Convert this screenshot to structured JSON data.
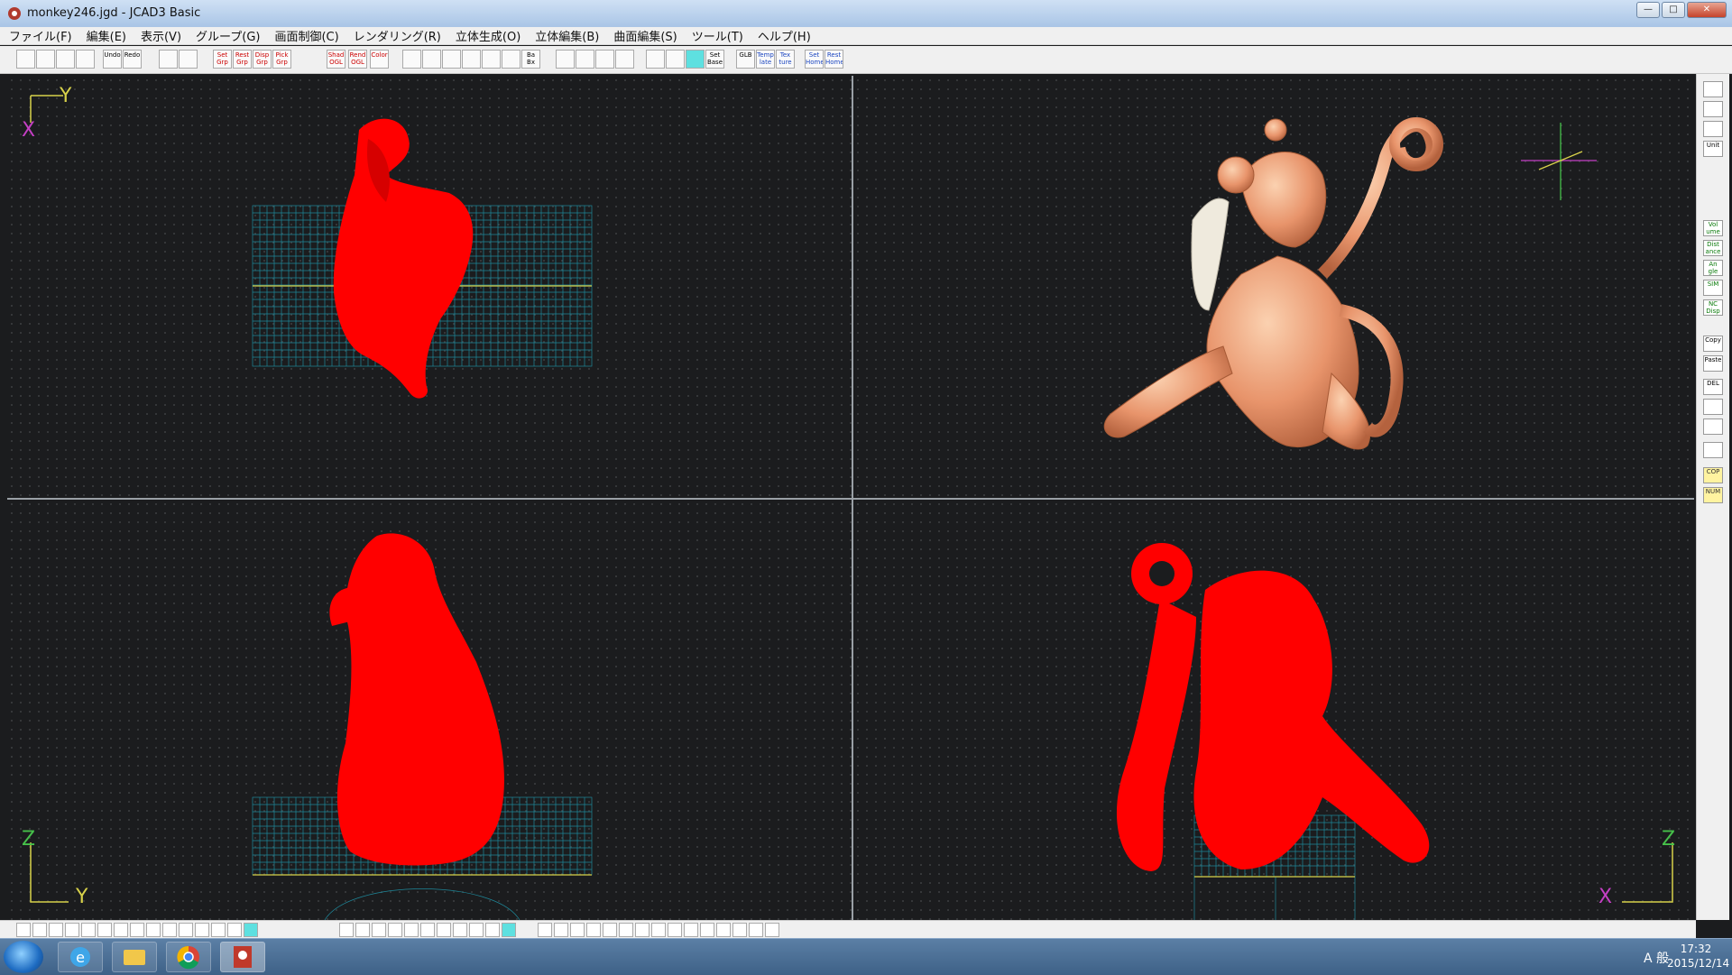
{
  "window": {
    "title": "monkey246.jgd - JCAD3 Basic",
    "buttons": [
      "—",
      "□",
      "✕"
    ]
  },
  "menu": [
    "ファイル(F)",
    "編集(E)",
    "表示(V)",
    "グループ(G)",
    "画面制御(C)",
    "レンダリング(R)",
    "立体生成(O)",
    "立体編集(B)",
    "曲面編集(S)",
    "ツール(T)",
    "ヘルプ(H)"
  ],
  "toolbar": {
    "buttons": [
      {
        "label": "",
        "name": "new-file"
      },
      {
        "label": "",
        "name": "open-file"
      },
      {
        "label": "",
        "name": "save-file"
      },
      {
        "label": "",
        "name": "print"
      },
      {
        "label": "Undo",
        "name": "undo"
      },
      {
        "label": "Redo",
        "name": "redo"
      },
      {
        "label": "",
        "name": "group-view"
      },
      {
        "label": "",
        "name": "group-list"
      },
      {
        "label": "Set Grp",
        "name": "set-group"
      },
      {
        "label": "Rest Grp",
        "name": "reset-group"
      },
      {
        "label": "Disp Grp",
        "name": "display-group"
      },
      {
        "label": "Pick Grp",
        "name": "pick-group"
      },
      {
        "label": "Shad OGL",
        "name": "shade-ogl"
      },
      {
        "label": "Rend OGL",
        "name": "render-ogl"
      },
      {
        "label": "Color",
        "name": "color"
      },
      {
        "label": "",
        "name": "zoom-in"
      },
      {
        "label": "",
        "name": "zoom-out"
      },
      {
        "label": "",
        "name": "zoom-fit"
      },
      {
        "label": "",
        "name": "zoom-window"
      },
      {
        "label": "",
        "name": "zoom-all"
      },
      {
        "label": "",
        "name": "pan-hand"
      },
      {
        "label": "Ba Bx",
        "name": "bbox"
      },
      {
        "label": "",
        "name": "zoom-red-1"
      },
      {
        "label": "",
        "name": "zoom-red-2"
      },
      {
        "label": "",
        "name": "zoom-red-3"
      },
      {
        "label": "",
        "name": "zoom-red-4"
      },
      {
        "label": "",
        "name": "grid-1"
      },
      {
        "label": "",
        "name": "grid-2"
      },
      {
        "label": "",
        "name": "grid-3"
      },
      {
        "label": "Set Base",
        "name": "set-base"
      },
      {
        "label": "GLB",
        "name": "global"
      },
      {
        "label": "Temp late",
        "name": "template"
      },
      {
        "label": "Tex ture",
        "name": "texture"
      },
      {
        "label": "Set Home",
        "name": "set-home"
      },
      {
        "label": "Rest Home",
        "name": "reset-home"
      }
    ]
  },
  "views": {
    "top_left": {
      "axis_v": "Y",
      "axis_h": "X"
    },
    "bottom_left": {
      "axis_v": "Z",
      "axis_h": "Y"
    },
    "bottom_right": {
      "axis_v": "Z",
      "axis_h": "X"
    }
  },
  "right_sidebar": [
    {
      "label": "",
      "name": "view-icon-1"
    },
    {
      "label": "",
      "name": "view-icon-2"
    },
    {
      "label": "",
      "name": "view-icon-3"
    },
    {
      "label": "Unit",
      "name": "unit"
    },
    {
      "label": "Vol ume",
      "name": "volume"
    },
    {
      "label": "Dist ance",
      "name": "distance"
    },
    {
      "label": "An gle",
      "name": "angle"
    },
    {
      "label": "SIM",
      "name": "sim"
    },
    {
      "label": "NC Disp",
      "name": "nc-disp"
    },
    {
      "label": "Copy",
      "name": "copy"
    },
    {
      "label": "Paste",
      "name": "paste"
    },
    {
      "label": "DEL",
      "name": "delete"
    },
    {
      "label": "",
      "name": "tool-a"
    },
    {
      "label": "",
      "name": "tool-b"
    },
    {
      "label": "",
      "name": "tool-c"
    },
    {
      "label": "COP",
      "name": "cop"
    },
    {
      "label": "NUM",
      "name": "num"
    }
  ],
  "taskbar": {
    "apps": [
      "internet-explorer",
      "file-explorer",
      "chrome",
      "jcad3"
    ],
    "clock_time": "17:32",
    "clock_date": "2015/12/14",
    "tray_text": "A 般"
  },
  "colors": {
    "wireframe": "#ff0000",
    "grid": "#1f9bb0",
    "axis_y": "#d8d24a",
    "axis_x": "#c43fc4",
    "monkey": "#e8946b"
  }
}
